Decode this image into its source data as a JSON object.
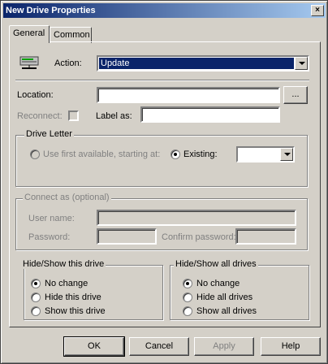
{
  "window": {
    "title": "New Drive Properties",
    "close_glyph": "×"
  },
  "tabs": [
    {
      "label": "General"
    },
    {
      "label": "Common"
    }
  ],
  "action": {
    "label": "Action:",
    "value": "Update",
    "icon": "network-drive-icon"
  },
  "location": {
    "label": "Location:",
    "value": "",
    "browse_label": "..."
  },
  "reconnect": {
    "label": "Reconnect:",
    "checked": false
  },
  "label_as": {
    "label": "Label as:",
    "value": ""
  },
  "drive_letter": {
    "title": "Drive Letter",
    "use_first_label": "Use first available, starting at:",
    "existing_label": "Existing:",
    "selected": "existing",
    "existing_value": ""
  },
  "connect_as": {
    "title": "Connect as (optional)",
    "username_label": "User name:",
    "password_label": "Password:",
    "confirm_label": "Confirm password:"
  },
  "hide_show_drive": {
    "title": "Hide/Show this drive",
    "options": [
      "No change",
      "Hide this drive",
      "Show this drive"
    ],
    "selected": 0
  },
  "hide_show_all": {
    "title": "Hide/Show all drives",
    "options": [
      "No change",
      "Hide all drives",
      "Show all drives"
    ],
    "selected": 0
  },
  "buttons": {
    "ok": "OK",
    "cancel": "Cancel",
    "apply": "Apply",
    "help": "Help"
  },
  "colors": {
    "title_bar": "#0a246a",
    "face": "#d4d0c8",
    "selection": "#0a246a"
  }
}
